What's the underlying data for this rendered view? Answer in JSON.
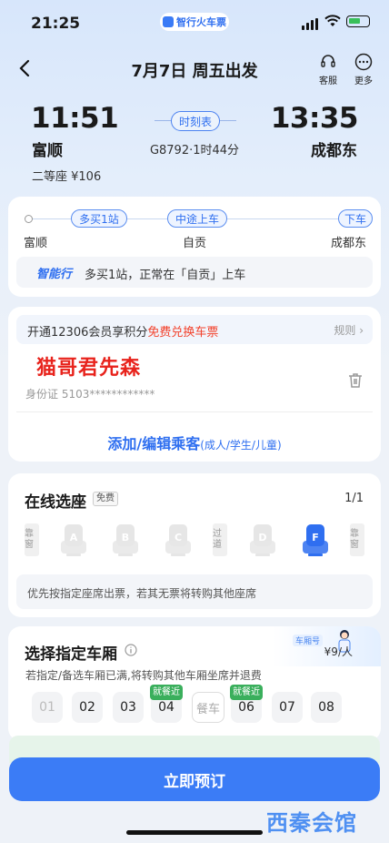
{
  "status_bar": {
    "time": "21:25",
    "app_name": "智行火车票"
  },
  "nav": {
    "title": "7月7日 周五出发",
    "service_label": "客服",
    "more_label": "更多"
  },
  "train": {
    "departure_time": "11:51",
    "departure_station": "富顺",
    "arrival_time": "13:35",
    "arrival_station": "成都东",
    "timetable_label": "时刻表",
    "info": "G8792·1时44分",
    "seat_price": "二等座 ¥106"
  },
  "route": {
    "tag_buy_more": "多买1站",
    "tag_board_midway": "中途上车",
    "tag_alight": "下车",
    "station_start": "富顺",
    "station_mid": "自贡",
    "station_end": "成都东",
    "smart_logo": "智能行",
    "smart_text": "多买1站，正常在「自贡」上车"
  },
  "passenger": {
    "member_text": "开通12306会员享积分",
    "member_highlight": "免费兑换车票",
    "rules_label": "规则 ›",
    "name": "猫哥君先森",
    "id_number": "身份证 5103************",
    "add_main": "添加/编辑乘客",
    "add_sub": "(成人/学生/儿童)"
  },
  "seat_selection": {
    "title": "在线选座",
    "free_badge": "免费",
    "count": "1/1",
    "window_label": "靠窗",
    "aisle_label": "过道",
    "seats": [
      "A",
      "B",
      "C",
      "D",
      "F"
    ],
    "selected_seat": "F",
    "note": "优先按指定座席出票，若其无票将转购其他座席"
  },
  "car_selection": {
    "title": "选择指定车厢",
    "price": "¥9/人",
    "ad_tag": "车厢号",
    "hint": "若指定/备选车厢已满,将转购其他车厢坐席并退费",
    "cars": [
      "01",
      "02",
      "03",
      "04",
      "餐车",
      "06",
      "07",
      "08"
    ],
    "near_dining_badge": "就餐近"
  },
  "footer": {
    "book_label": "立即预订",
    "watermark": "西秦会馆"
  },
  "colors": {
    "accent": "#3b7cf6",
    "selected_seat": "#2f6ff0",
    "red": "#f2412b",
    "badge_green": "#3aaf5c"
  }
}
